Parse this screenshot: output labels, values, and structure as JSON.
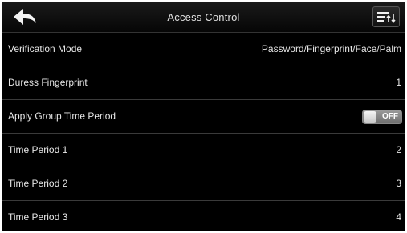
{
  "header": {
    "title": "Access Control",
    "back_icon": "back-arrow-icon",
    "menu_icon": "sort-menu-icon"
  },
  "rows": [
    {
      "label": "Verification Mode",
      "value": "Password/Fingerprint/Face/Palm"
    },
    {
      "label": "Duress Fingerprint",
      "value": "1"
    },
    {
      "label": "Apply Group Time Period",
      "toggle_text": "OFF",
      "toggle_on": false
    },
    {
      "label": "Time Period 1",
      "value": "2"
    },
    {
      "label": "Time Period 2",
      "value": "3"
    },
    {
      "label": "Time Period 3",
      "value": "4"
    }
  ],
  "colors": {
    "background": "#000000",
    "text": "#e6e6e6",
    "divider": "#3a3a3a"
  }
}
